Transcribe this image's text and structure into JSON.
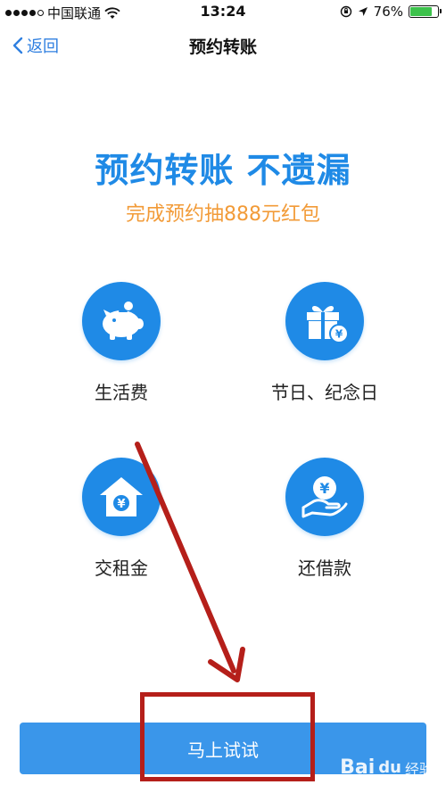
{
  "status_bar": {
    "carrier": "中国联通",
    "time": "13:24",
    "battery": "76%",
    "battery_level": 0.76
  },
  "nav": {
    "back_label": "返回",
    "title": "预约转账"
  },
  "hero": {
    "headline": "预约转账 不遗漏",
    "subline": "完成预约抽888元红包"
  },
  "options": [
    {
      "label": "生活费",
      "icon": "piggy-bank-icon"
    },
    {
      "label": "节日、纪念日",
      "icon": "gift-icon"
    },
    {
      "label": "交租金",
      "icon": "house-icon"
    },
    {
      "label": "还借款",
      "icon": "coin-hand-icon"
    }
  ],
  "cta": {
    "label": "马上试试"
  },
  "watermark": {
    "text": "Bai",
    "paw": "du",
    "sub": "经验"
  },
  "colors": {
    "primary": "#1f8ae6",
    "accent_orange": "#f29b38",
    "button": "#3a96ea",
    "annotation_red": "#b51f1a"
  }
}
